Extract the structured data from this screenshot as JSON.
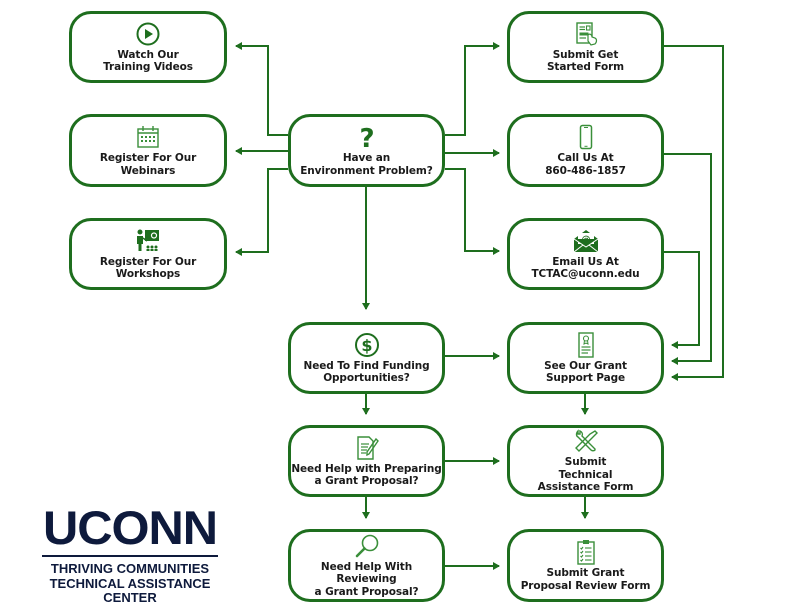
{
  "colors": {
    "accent": "#1e6e1e",
    "text": "#1a1a1a",
    "brand": "#0e1a3c",
    "background": "#ffffff"
  },
  "nodes": {
    "watch_videos": {
      "label": "Watch Our\nTraining Videos",
      "icon": "play-circle-icon"
    },
    "webinars": {
      "label": "Register For Our\nWebinars",
      "icon": "calendar-icon"
    },
    "workshops": {
      "label": "Register For Our\nWorkshops",
      "icon": "presenter-icon"
    },
    "environment_problem": {
      "label": "Have an\nEnvironment Problem?",
      "icon": "question-mark-icon"
    },
    "funding": {
      "label": "Need To Find Funding\nOpportunities?",
      "icon": "dollar-circle-icon"
    },
    "preparing": {
      "label": "Need Help with Preparing\na Grant Proposal?",
      "icon": "document-pen-icon"
    },
    "reviewing": {
      "label": "Need Help With Reviewing\na Grant Proposal?",
      "icon": "magnifier-icon"
    },
    "get_started": {
      "label": "Submit Get\nStarted Form",
      "icon": "form-click-icon"
    },
    "call": {
      "label": "Call Us At\n860-486-1857",
      "icon": "phone-icon"
    },
    "email": {
      "label": "Email Us At\nTCTAC@uconn.edu",
      "icon": "envelope-at-icon"
    },
    "grant_support": {
      "label": "See Our Grant\nSupport Page",
      "icon": "certificate-icon"
    },
    "tech_assist": {
      "label": "Submit\nTechnical\nAssistance Form",
      "icon": "tools-icon"
    },
    "review_form": {
      "label": "Submit Grant\nProposal Review Form",
      "icon": "clipboard-checklist-icon"
    }
  },
  "edges": [
    {
      "from": "environment_problem",
      "to": "watch_videos"
    },
    {
      "from": "environment_problem",
      "to": "webinars"
    },
    {
      "from": "environment_problem",
      "to": "workshops"
    },
    {
      "from": "environment_problem",
      "to": "get_started"
    },
    {
      "from": "environment_problem",
      "to": "call"
    },
    {
      "from": "environment_problem",
      "to": "email"
    },
    {
      "from": "environment_problem",
      "to": "funding"
    },
    {
      "from": "funding",
      "to": "grant_support"
    },
    {
      "from": "funding",
      "to": "preparing"
    },
    {
      "from": "preparing",
      "to": "tech_assist"
    },
    {
      "from": "preparing",
      "to": "reviewing"
    },
    {
      "from": "reviewing",
      "to": "review_form"
    },
    {
      "from": "grant_support",
      "to": "tech_assist"
    },
    {
      "from": "tech_assist",
      "to": "review_form"
    },
    {
      "from": "get_started",
      "to": "grant_support"
    },
    {
      "from": "call",
      "to": "grant_support"
    },
    {
      "from": "email",
      "to": "grant_support"
    }
  ],
  "logo": {
    "brand": "UCONN",
    "subtitle": "THRIVING COMMUNITIES\nTECHNICAL ASSISTANCE\nCENTER"
  }
}
